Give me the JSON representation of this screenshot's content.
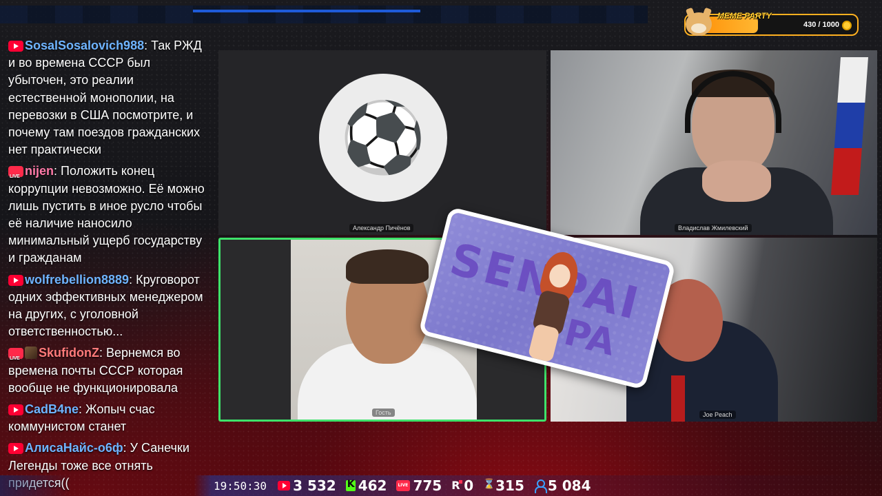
{
  "chat": {
    "messages": [
      {
        "platform": "youtube",
        "user": "SosalSosalovich988",
        "user_color": "#6fb4ff",
        "text": "Так РЖД и во времена СССР был убыточен, это реалии естественной монополии, на перевозки в США посмотрите, и почему там поездов гражданских нет практически"
      },
      {
        "platform": "vk",
        "user": "nijen",
        "user_color": "#ff7aa8",
        "text": "Положить конец коррупции невозможно. Её можно лишь пустить в иное русло чтобы её наличие наносило минимальный ущерб государству и гражданам"
      },
      {
        "platform": "youtube",
        "user": "wolfrebellion8889",
        "user_color": "#6fb4ff",
        "text": "Круговорот одних эффективных менеджером на других, с уголовной ответственностью..."
      },
      {
        "platform": "vk",
        "user": "SkufidonZ",
        "user_color": "#ff7a7a",
        "avatar": true,
        "text": "Вернемся во времена почты СССР которая вообще не функционировала"
      },
      {
        "platform": "youtube",
        "user": "CadB4ne",
        "user_color": "#6fb4ff",
        "text": "Жопыч счас коммунистом станет"
      },
      {
        "platform": "youtube",
        "user": "АлисаНайс-о6ф",
        "user_color": "#6fb4ff",
        "text": "У Санечки Легенды тоже все отнять придется(("
      }
    ]
  },
  "video": {
    "tile1_name": "Александр Пичёнов",
    "tile1_avatar": "⚽",
    "tile2_name": "Владислав Жмилевский",
    "tile3_name": "Гость",
    "tile4_name": "Joe Peach"
  },
  "sticker": {
    "text1": "SENPAI",
    "text2": "PA"
  },
  "meme_party": {
    "label": "MEME PARTY",
    "progress_text": "430 / 1000",
    "progress": 0.43
  },
  "stats": {
    "time": "19:50:30",
    "youtube": "3 532",
    "kick": "462",
    "vk": "775",
    "rutube": "0",
    "twitch": "315",
    "total": "5 084"
  }
}
